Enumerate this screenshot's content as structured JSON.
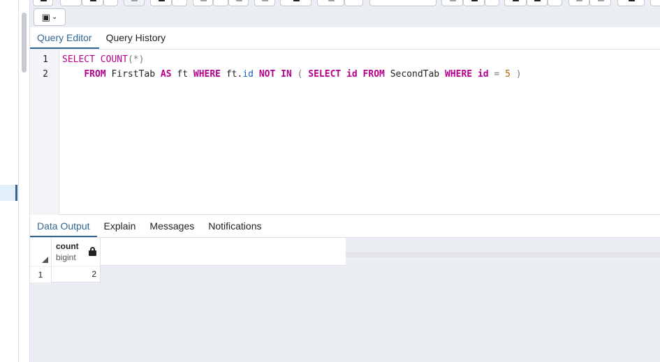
{
  "query_tabs": [
    {
      "label": "Query Editor",
      "active": true
    },
    {
      "label": "Query History",
      "active": false
    }
  ],
  "editor": {
    "line_numbers": [
      "1",
      "2"
    ],
    "line1": {
      "kw_select": "SELECT",
      "fn_count": "COUNT",
      "args": "(*)"
    },
    "line2": {
      "indent": "    ",
      "kw_from": "FROM",
      "table1": "FirstTab",
      "kw_as": "AS",
      "alias": "ft",
      "kw_where": "WHERE",
      "alias_ref": "ft.",
      "col_id": "id",
      "kw_not": "NOT",
      "kw_in": "IN",
      "paren_open": "(",
      "kw_select2": "SELECT",
      "col_id2": "id",
      "kw_from2": "FROM",
      "table2": "SecondTab",
      "kw_where2": "WHERE",
      "col_id3": "id",
      "op_eq": "=",
      "value": "5",
      "paren_close": ")"
    }
  },
  "output_tabs": [
    {
      "label": "Data Output",
      "active": true
    },
    {
      "label": "Explain",
      "active": false
    },
    {
      "label": "Messages",
      "active": false
    },
    {
      "label": "Notifications",
      "active": false
    }
  ],
  "grid": {
    "columns": [
      {
        "name": "count",
        "type": "bigint",
        "icon": "lock-icon"
      }
    ],
    "rows": [
      {
        "row_no": "1",
        "values": [
          "2"
        ]
      }
    ]
  },
  "colors": {
    "accent": "#326690",
    "keyword": "#b4008c",
    "identifier": "#1a5fb4",
    "number": "#b16600"
  }
}
